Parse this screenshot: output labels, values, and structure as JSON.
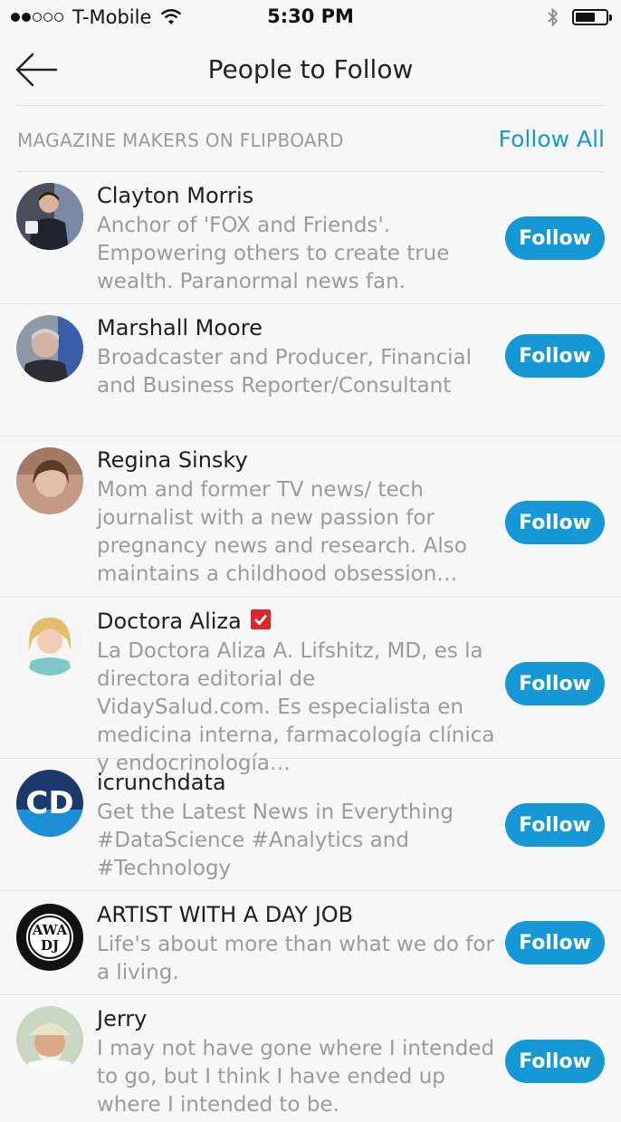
{
  "status_bar": {
    "carrier": "T-Mobile",
    "time": "5:30 PM",
    "signal_bars_filled": 2,
    "signal_bars_total": 5,
    "battery_level": 0.65
  },
  "nav": {
    "title": "People to Follow",
    "back_icon": "arrow-left-icon"
  },
  "section": {
    "title": "MAGAZINE MAKERS ON FLIPBOARD",
    "follow_all_label": "Follow All"
  },
  "people": [
    {
      "name": "Clayton Morris",
      "bio": "Anchor of 'FOX and Friends'. Empowering others to create true wealth. Paranormal news fan.",
      "follow_label": "Follow"
    },
    {
      "name": "Marshall Moore",
      "bio": "Broadcaster and Producer, Financial and Business Reporter/Consultant",
      "follow_label": "Follow"
    },
    {
      "name": "Regina Sinsky",
      "bio": "Mom and former TV news/ tech journalist with a new passion for pregnancy news and research. Also maintains a childhood obsession…",
      "follow_label": "Follow"
    },
    {
      "name": "Doctora Aliza",
      "verified": true,
      "bio": "La Doctora Aliza A. Lifshitz, MD, es la directora editorial de VidaySalud.com. Es especialista en medicina interna, farmacología clínica y endocrinología…",
      "follow_label": "Follow"
    },
    {
      "name": "icrunchdata",
      "bio": "Get the Latest News in Everything #DataScience #Analytics and #Technology",
      "follow_label": "Follow"
    },
    {
      "name": "ARTIST WITH A DAY JOB",
      "bio": "Life's about more than what we do for a living.",
      "follow_label": "Follow"
    },
    {
      "name": "Jerry",
      "bio": "I may not have gone where I intended to go, but I think I have ended up where I intended to be.",
      "follow_label": "Follow"
    }
  ],
  "colors": {
    "accent": "#1598d5",
    "verified": "#e0262b"
  }
}
